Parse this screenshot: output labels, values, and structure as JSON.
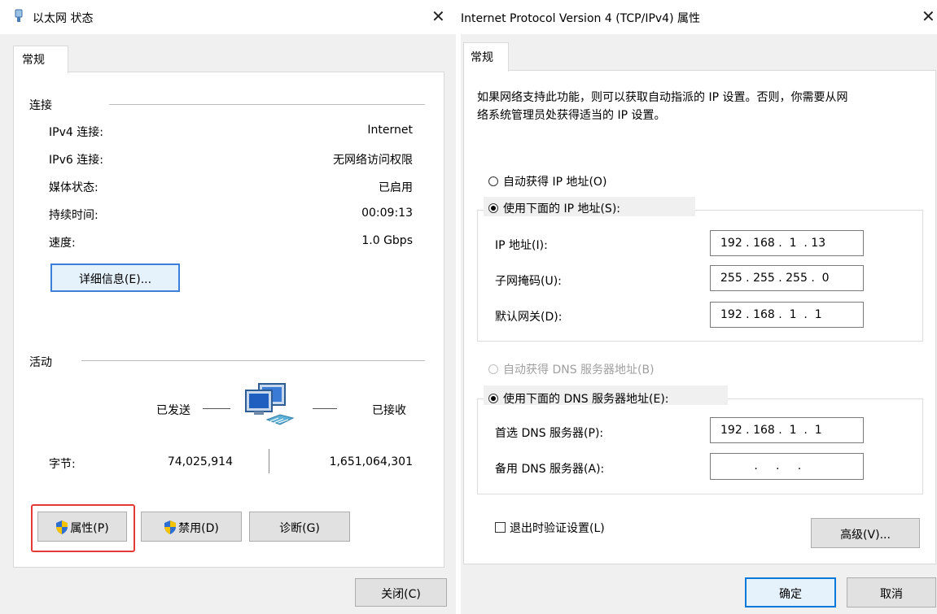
{
  "left_window": {
    "title": "以太网 状态",
    "close_glyph": "✕",
    "tab": "常规",
    "connection": {
      "header": "连接",
      "rows": [
        {
          "label": "IPv4 连接:",
          "value": "Internet"
        },
        {
          "label": "IPv6 连接:",
          "value": "无网络访问权限"
        },
        {
          "label": "媒体状态:",
          "value": "已启用"
        },
        {
          "label": "持续时间:",
          "value": "00:09:13"
        },
        {
          "label": "速度:",
          "value": "1.0 Gbps"
        }
      ],
      "details_button": "详细信息(E)..."
    },
    "activity": {
      "header": "活动",
      "sent_label": "已发送",
      "received_label": "已接收",
      "bytes_label": "字节:",
      "bytes_sent": "74,025,914",
      "bytes_received": "1,651,064,301"
    },
    "buttons": {
      "properties": "属性(P)",
      "disable": "禁用(D)",
      "diagnose": "诊断(G)",
      "close": "关闭(C)"
    }
  },
  "right_window": {
    "title": "Internet Protocol Version 4 (TCP/IPv4) 属性",
    "close_glyph": "✕",
    "tab": "常规",
    "description_line1": "如果网络支持此功能，则可以获取自动指派的 IP 设置。否则，你需要从网",
    "description_line2": "络系统管理员处获得适当的 IP 设置。",
    "ip": {
      "auto_option": "自动获得 IP 地址(O)",
      "manual_option": "使用下面的 IP 地址(S):",
      "selected": "manual",
      "fields": [
        {
          "label": "IP 地址(I):",
          "value": "192 . 168 .  1  . 13"
        },
        {
          "label": "子网掩码(U):",
          "value": "255 . 255 . 255 .  0"
        },
        {
          "label": "默认网关(D):",
          "value": "192 . 168 .  1  .  1"
        }
      ]
    },
    "dns": {
      "auto_option": "自动获得 DNS 服务器地址(B)",
      "manual_option": "使用下面的 DNS 服务器地址(E):",
      "selected": "manual",
      "fields": [
        {
          "label": "首选 DNS 服务器(P):",
          "value": "192 . 168 .  1  .  1"
        },
        {
          "label": "备用 DNS 服务器(A):",
          "value": "   .     .     .   "
        }
      ]
    },
    "validate_checkbox": "退出时验证设置(L)",
    "validate_checked": false,
    "advanced_button": "高级(V)...",
    "ok_button": "确定",
    "cancel_button": "取消"
  },
  "colors": {
    "highlight_border": "#e53935",
    "primary_border": "#0078d7",
    "window_bg": "#f0f0f0"
  }
}
